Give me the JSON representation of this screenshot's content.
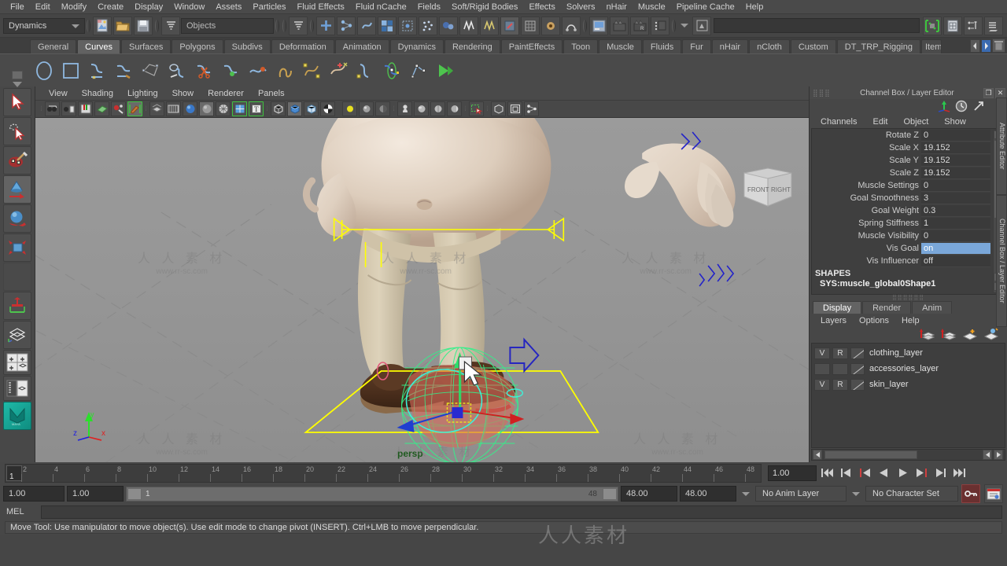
{
  "menubar": {
    "items": [
      "File",
      "Edit",
      "Modify",
      "Create",
      "Display",
      "Window",
      "Assets",
      "Particles",
      "Fluid Effects",
      "Fluid nCache",
      "Fields",
      "Soft/Rigid Bodies",
      "Effects",
      "Solvers",
      "nHair",
      "Muscle",
      "Pipeline Cache",
      "Help"
    ]
  },
  "statusline": {
    "mode": "Dynamics",
    "object_field": "Objects",
    "search_value": "",
    "icons": [
      "new-scene-icon",
      "open-scene-icon",
      "save-scene-icon",
      "selection-mask-icon",
      "select-by-hierarchy-icon",
      "select-by-object-icon",
      "select-by-component-icon",
      "snap-grid-icon",
      "snap-curve-icon",
      "snap-point-icon",
      "snap-view-plane-icon",
      "magnet-icon",
      "make-live-icon",
      "render-current-frame-icon",
      "ipr-render-icon",
      "render-settings-icon",
      "render-globals-icon",
      "toggle-sidebar-icon",
      "attribute-editor-icon",
      "tool-settings-icon",
      "channel-box-icon"
    ]
  },
  "shelf": {
    "tabs": [
      "General",
      "Curves",
      "Surfaces",
      "Polygons",
      "Subdivs",
      "Deformation",
      "Animation",
      "Dynamics",
      "Rendering",
      "PaintEffects",
      "Toon",
      "Muscle",
      "Fluids",
      "Fur",
      "nHair",
      "nCloth",
      "Custom",
      "DT_TRP_Rigging",
      "Item"
    ],
    "active_tab": "Curves",
    "icons": [
      "circle-curve-icon",
      "square-curve-icon",
      "cv-curve-icon",
      "ep-curve-icon",
      "pencil-curve-icon",
      "arc-curve-icon",
      "bezier-curve-icon",
      "cut-curve-icon",
      "attach-curve-icon",
      "detach-curve-icon",
      "align-curve-icon",
      "open-close-curve-icon",
      "insert-knot-icon",
      "extend-curve-icon",
      "offset-curve-icon",
      "reverse-curve-icon",
      "rebuild-curve-icon",
      "fit-bspline-icon",
      "smooth-curve-icon",
      "curve-playback-icon"
    ]
  },
  "toolbox": {
    "tools": [
      {
        "name": "select-tool",
        "selected": false
      },
      {
        "name": "lasso-select-tool",
        "selected": false
      },
      {
        "name": "paint-select-tool",
        "selected": false
      },
      {
        "name": "move-tool",
        "selected": true
      },
      {
        "name": "rotate-tool",
        "selected": false
      },
      {
        "name": "scale-tool",
        "selected": false
      },
      {
        "name": "blank-tool",
        "selected": false
      },
      {
        "name": "last-tool-used",
        "selected": false
      },
      {
        "name": "single-perspective-layout-icon",
        "selected": false
      },
      {
        "name": "four-view-layout-icon",
        "selected": false
      },
      {
        "name": "outliner-persp-layout-icon",
        "selected": false
      },
      {
        "name": "maya-logo-icon",
        "selected": false
      }
    ]
  },
  "viewport": {
    "menu": [
      "View",
      "Shading",
      "Lighting",
      "Show",
      "Renderer",
      "Panels"
    ],
    "camera_label": "persp",
    "viewcube": {
      "front": "FRONT",
      "right": "RIGHT"
    },
    "axis": {
      "x": "x",
      "y": "y",
      "z": "z"
    },
    "watermark_text": "人 人 素 材",
    "watermark_sub": "www.rr-sc.com",
    "toolbar_icons": [
      "select-camera-icon",
      "camera-attributes-icon",
      "bookmark-icon",
      "image-plane-icon",
      "two-dimensional-pan-zoom-icon",
      "grease-pencil-icon",
      "xray-icon",
      "film-gate-icon",
      "smooth-shade-all-icon",
      "flat-shade-icon",
      "wireframe-on-shaded-icon",
      "texture-icon",
      "lights-icon",
      "shadows-icon",
      "wireframe-mode-icon",
      "smooth-shaded-mode-icon",
      "shaded-textured-icon",
      "high-quality-render-icon",
      "use-default-light-icon",
      "use-all-lights-icon",
      "shadow-toggle-icon",
      "ambient-occlusion-icon",
      "motion-blur-icon",
      "isolate-select-icon",
      "xray-joints-icon",
      "xray-active-icon",
      "display-sets-icon"
    ]
  },
  "channelbox": {
    "title": "Channel Box / Layer Editor",
    "menu": [
      "Channels",
      "Edit",
      "Object",
      "Show"
    ],
    "icons": [
      "transform-manip-icon",
      "clock-icon",
      "arrow-icon"
    ],
    "channels": [
      {
        "name": "Rotate Z",
        "value": "0",
        "highlight": false
      },
      {
        "name": "Scale X",
        "value": "19.152",
        "highlight": false
      },
      {
        "name": "Scale Y",
        "value": "19.152",
        "highlight": false
      },
      {
        "name": "Scale Z",
        "value": "19.152",
        "highlight": false
      },
      {
        "name": "Muscle Settings",
        "value": "0",
        "highlight": false
      },
      {
        "name": "Goal Smoothness",
        "value": "3",
        "highlight": false
      },
      {
        "name": "Goal Weight",
        "value": "0.3",
        "highlight": false
      },
      {
        "name": "Spring Stiffness",
        "value": "1",
        "highlight": false
      },
      {
        "name": "Muscle Visibility",
        "value": "0",
        "highlight": false
      },
      {
        "name": "Vis Goal",
        "value": "on",
        "highlight": true
      },
      {
        "name": "Vis Influencer",
        "value": "off",
        "highlight": false
      }
    ],
    "shapes_header": "SHAPES",
    "shape_name": "SYS:muscle_global0Shape1"
  },
  "sidetabs": [
    "Attribute Editor",
    "Channel Box / Layer Editor"
  ],
  "layereditor": {
    "tabs": [
      "Display",
      "Render",
      "Anim"
    ],
    "active_tab": "Display",
    "menu": [
      "Layers",
      "Options",
      "Help"
    ],
    "icons": [
      "new-layer-icon",
      "new-layer-from-selected-icon",
      "layer-1-icon",
      "layer-2-icon"
    ],
    "layers": [
      {
        "visible": "V",
        "render": "R",
        "name": "clothing_layer"
      },
      {
        "visible": "",
        "render": "",
        "name": "accessories_layer"
      },
      {
        "visible": "V",
        "render": "R",
        "name": "skin_layer"
      }
    ]
  },
  "timeslider": {
    "current_frame": "1",
    "ticks": [
      2,
      4,
      6,
      8,
      10,
      12,
      14,
      16,
      18,
      20,
      22,
      24,
      26,
      28,
      30,
      32,
      34,
      36,
      38,
      40,
      42,
      44,
      46,
      48
    ],
    "playback_speed": "1.00",
    "buttons": [
      "go-to-start-icon",
      "step-back-frame-icon",
      "step-back-key-icon",
      "play-backwards-icon",
      "play-forwards-icon",
      "step-forward-key-icon",
      "step-forward-frame-icon",
      "go-to-end-icon"
    ]
  },
  "rangeslider": {
    "anim_start": "1.00",
    "range_start": "1.00",
    "range_bar_start": "1",
    "range_bar_end": "48",
    "range_end": "48.00",
    "anim_end": "48.00",
    "anim_layer": "No Anim Layer",
    "character_set": "No Character Set",
    "icons": [
      "auto-key-icon",
      "animation-preferences-icon"
    ]
  },
  "commandline": {
    "label": "MEL",
    "input_value": "",
    "help_text": "Move Tool: Use manipulator to move object(s). Use edit mode to change pivot (INSERT).  Ctrl+LMB to move perpendicular."
  },
  "colors": {
    "bg": "#464646",
    "panel": "#474747",
    "viewport_bg": "#979797",
    "highlight": "#7aa7d9",
    "accent_green": "#2ae06a",
    "accent_yellow": "#ffff00",
    "accent_red": "#cc2020",
    "accent_blue": "#2020cc"
  }
}
